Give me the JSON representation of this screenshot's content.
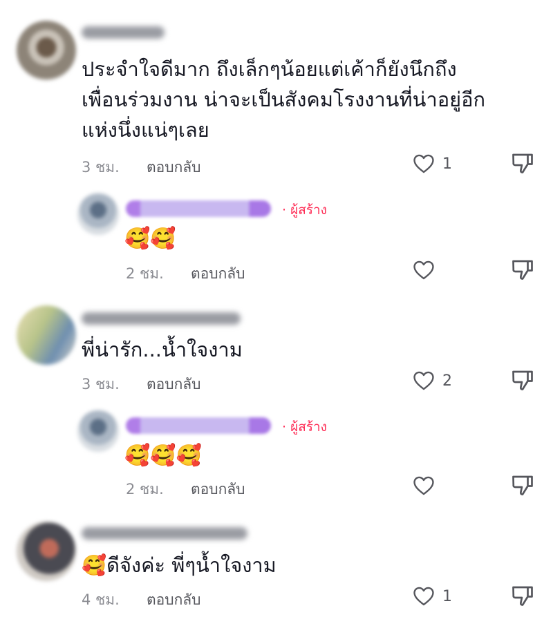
{
  "comments": [
    {
      "text_lines": [
        "ประจำใจดีมาก  ถึงเล็กๆน้อยแต่เค้าก็ยังนึกถึง",
        "เพื่อนร่วมงาน  น่าจะเป็นสังคมโรงงานที่น่าอยู่อีก",
        "แห่งนึ่งแน่ๆเลย"
      ],
      "time": "3 ชม.",
      "reply_label": "ตอบกลับ",
      "like_count": "1",
      "replies": [
        {
          "creator_label": "· ผู้สร้าง",
          "emoji": "🥰🥰",
          "time": "2 ชม.",
          "reply_label": "ตอบกลับ"
        }
      ]
    },
    {
      "text_lines": [
        "พี่น่ารัก...น้ำใจงาม"
      ],
      "time": "3 ชม.",
      "reply_label": "ตอบกลับ",
      "like_count": "2",
      "replies": [
        {
          "creator_label": "· ผู้สร้าง",
          "emoji": "🥰🥰🥰",
          "time": "2 ชม.",
          "reply_label": "ตอบกลับ"
        }
      ]
    },
    {
      "text_lines": [
        "🥰ดีจังค่ะ พี่ๆน้ำใจงาม"
      ],
      "time": "4 ชม.",
      "reply_label": "ตอบกลับ",
      "like_count": "1",
      "replies": []
    }
  ],
  "icons": {
    "like": "heart-outline-icon",
    "dislike": "thumbs-down-icon"
  }
}
